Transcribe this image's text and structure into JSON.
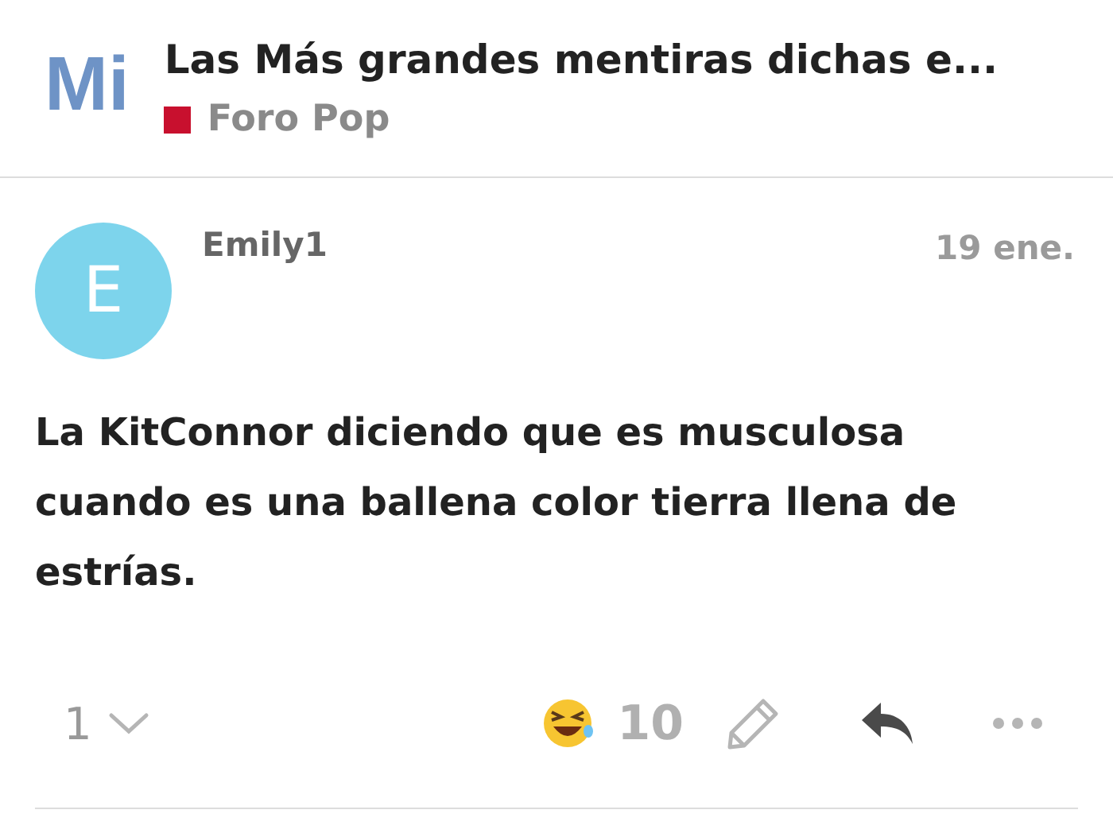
{
  "header": {
    "logo": "Mi",
    "title": "Las Más grandes mentiras dichas e...",
    "category": {
      "name": "Foro Pop",
      "color": "#c8102e"
    }
  },
  "post": {
    "avatar_letter": "E",
    "username": "Emily1",
    "date": "19 ene.",
    "body": "La KitConnor diciendo que es musculosa cuando es una ballena color tierra llena de estrías.",
    "replies_count": "1",
    "reaction_count": "10"
  }
}
